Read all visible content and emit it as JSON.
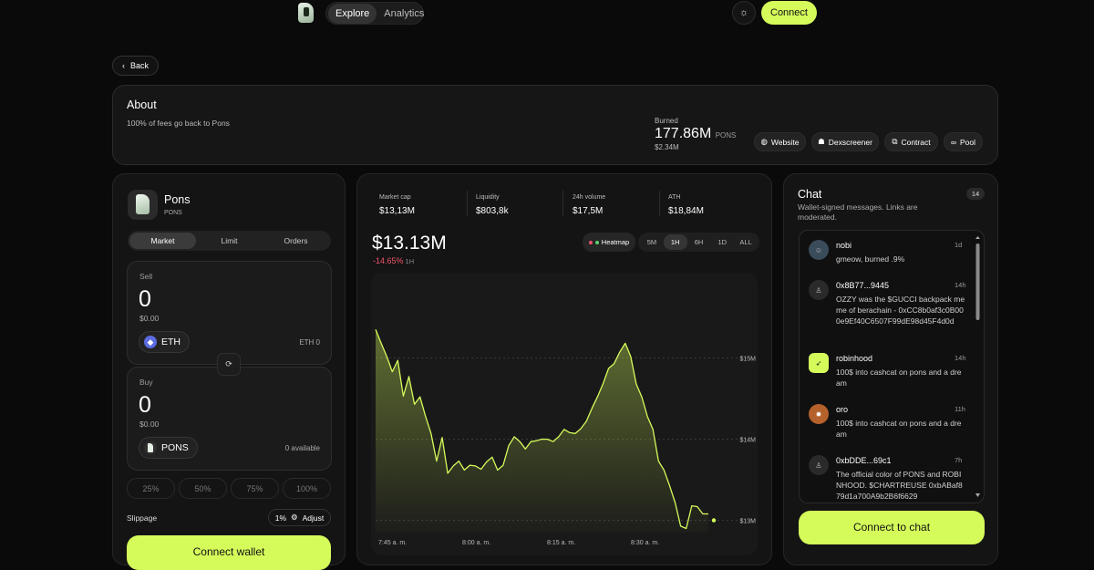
{
  "nav": {
    "tabs": [
      "Explore",
      "Analytics"
    ],
    "theme_icon": "sun-icon",
    "connect": "Connect"
  },
  "back": {
    "label": "Back"
  },
  "about": {
    "title": "About",
    "description": "100% of fees go back to Pons",
    "burned_label": "Burned",
    "burned_value": "177.86M",
    "burned_unit": "PONS",
    "burned_usd": "$2.34M",
    "links": [
      {
        "label": "Website",
        "icon": "globe-icon"
      },
      {
        "label": "Dexscreener",
        "icon": "dexscreener-icon"
      },
      {
        "label": "Contract",
        "icon": "copy-icon"
      },
      {
        "label": "Pool",
        "icon": "link-icon"
      }
    ]
  },
  "trade": {
    "token_name": "Pons",
    "token_symbol": "PONS",
    "tabs": [
      "Market",
      "Limit",
      "Orders"
    ],
    "sell": {
      "label": "Sell",
      "amount": "0",
      "usd": "$0.00",
      "token": "ETH",
      "balance": "ETH 0"
    },
    "buy": {
      "label": "Buy",
      "amount": "0",
      "usd": "$0.00",
      "token": "PONS",
      "balance": "0 available"
    },
    "percents": [
      "25%",
      "50%",
      "75%",
      "100%"
    ],
    "slippage_label": "Slippage",
    "slippage_value": "1%",
    "adjust": "Adjust",
    "connect_wallet": "Connect wallet"
  },
  "stats": [
    {
      "label": "Market cap",
      "value": "$13,13M"
    },
    {
      "label": "Liquidity",
      "value": "$803,8k"
    },
    {
      "label": "24h volume",
      "value": "$17,5M"
    },
    {
      "label": "ATH",
      "value": "$18,84M"
    }
  ],
  "price": {
    "value": "$13.13M",
    "change": "-14.65%",
    "period": "1H"
  },
  "heatmap": "Heatmap",
  "timeframes": [
    "5M",
    "1H",
    "6H",
    "1D",
    "ALL"
  ],
  "chart_data": {
    "type": "area",
    "color": "#d5fb5b",
    "x_ticks": [
      "7:45 a. m.",
      "8:00 a. m.",
      "8:15 a. m.",
      "8:30 a. m."
    ],
    "y_ticks": [
      "$15M",
      "$14M",
      "$13M"
    ],
    "ylim": [
      12.85,
      15.6
    ],
    "x": [
      0,
      1,
      2,
      3,
      4,
      5,
      6,
      7,
      8,
      9,
      10,
      11,
      12,
      13,
      14,
      15,
      16,
      17,
      18,
      19,
      20,
      21,
      22,
      23,
      24,
      25,
      26,
      27,
      28,
      29,
      30,
      31,
      32,
      33,
      34,
      35,
      36,
      37,
      38,
      39,
      40,
      41,
      42,
      43,
      44,
      45,
      46,
      47,
      48,
      49,
      50,
      51,
      52,
      53,
      54,
      55,
      56,
      57,
      58,
      59,
      60
    ],
    "values": [
      15.35,
      15.2,
      15.0,
      14.85,
      14.95,
      14.55,
      14.75,
      14.45,
      14.5,
      14.3,
      14.05,
      13.75,
      14.0,
      13.6,
      13.65,
      13.75,
      13.6,
      13.7,
      13.65,
      13.65,
      13.7,
      13.8,
      13.6,
      13.7,
      13.9,
      14.05,
      13.95,
      13.9,
      13.95,
      14.0,
      13.98,
      14.02,
      13.95,
      14.05,
      14.1,
      14.1,
      14.05,
      14.15,
      14.2,
      14.4,
      14.5,
      14.7,
      14.85,
      14.95,
      15.05,
      15.2,
      15.0,
      14.7,
      14.5,
      14.3,
      14.1,
      13.75,
      13.6,
      13.45,
      13.2,
      12.95,
      12.88,
      13.2,
      13.15,
      13.1,
      13.08
    ]
  },
  "chat": {
    "title": "Chat",
    "subtitle": "Wallet-signed messages. Links are moderated.",
    "count": "14",
    "messages": [
      {
        "name": "nobi",
        "time": "1d",
        "text": "gmeow, burned .9%",
        "avatar": "anime-avatar"
      },
      {
        "name": "0x8B77...9445",
        "time": "14h",
        "text": "OZZY was the $GUCCI backpack meme of berachain - 0xCC8b0af3c0B000e9Ef40C6507F99dE98d45F4d0d",
        "avatar": "user-icon"
      },
      {
        "name": "robinhood",
        "time": "14h",
        "text": "100$ into cashcat on pons and a dream",
        "avatar": "robinhood-avatar"
      },
      {
        "name": "oro",
        "time": "11h",
        "text": "100$ into cashcat on pons and a dream",
        "avatar": "pixel-avatar"
      },
      {
        "name": "0xbDDE...69c1",
        "time": "7h",
        "text": "The official color of PONS and ROBINHOOD. $CHARTREUSE 0xbABaf879d1a700A9b2B6f6629",
        "avatar": "user-icon"
      }
    ],
    "connect": "Connect to chat"
  }
}
